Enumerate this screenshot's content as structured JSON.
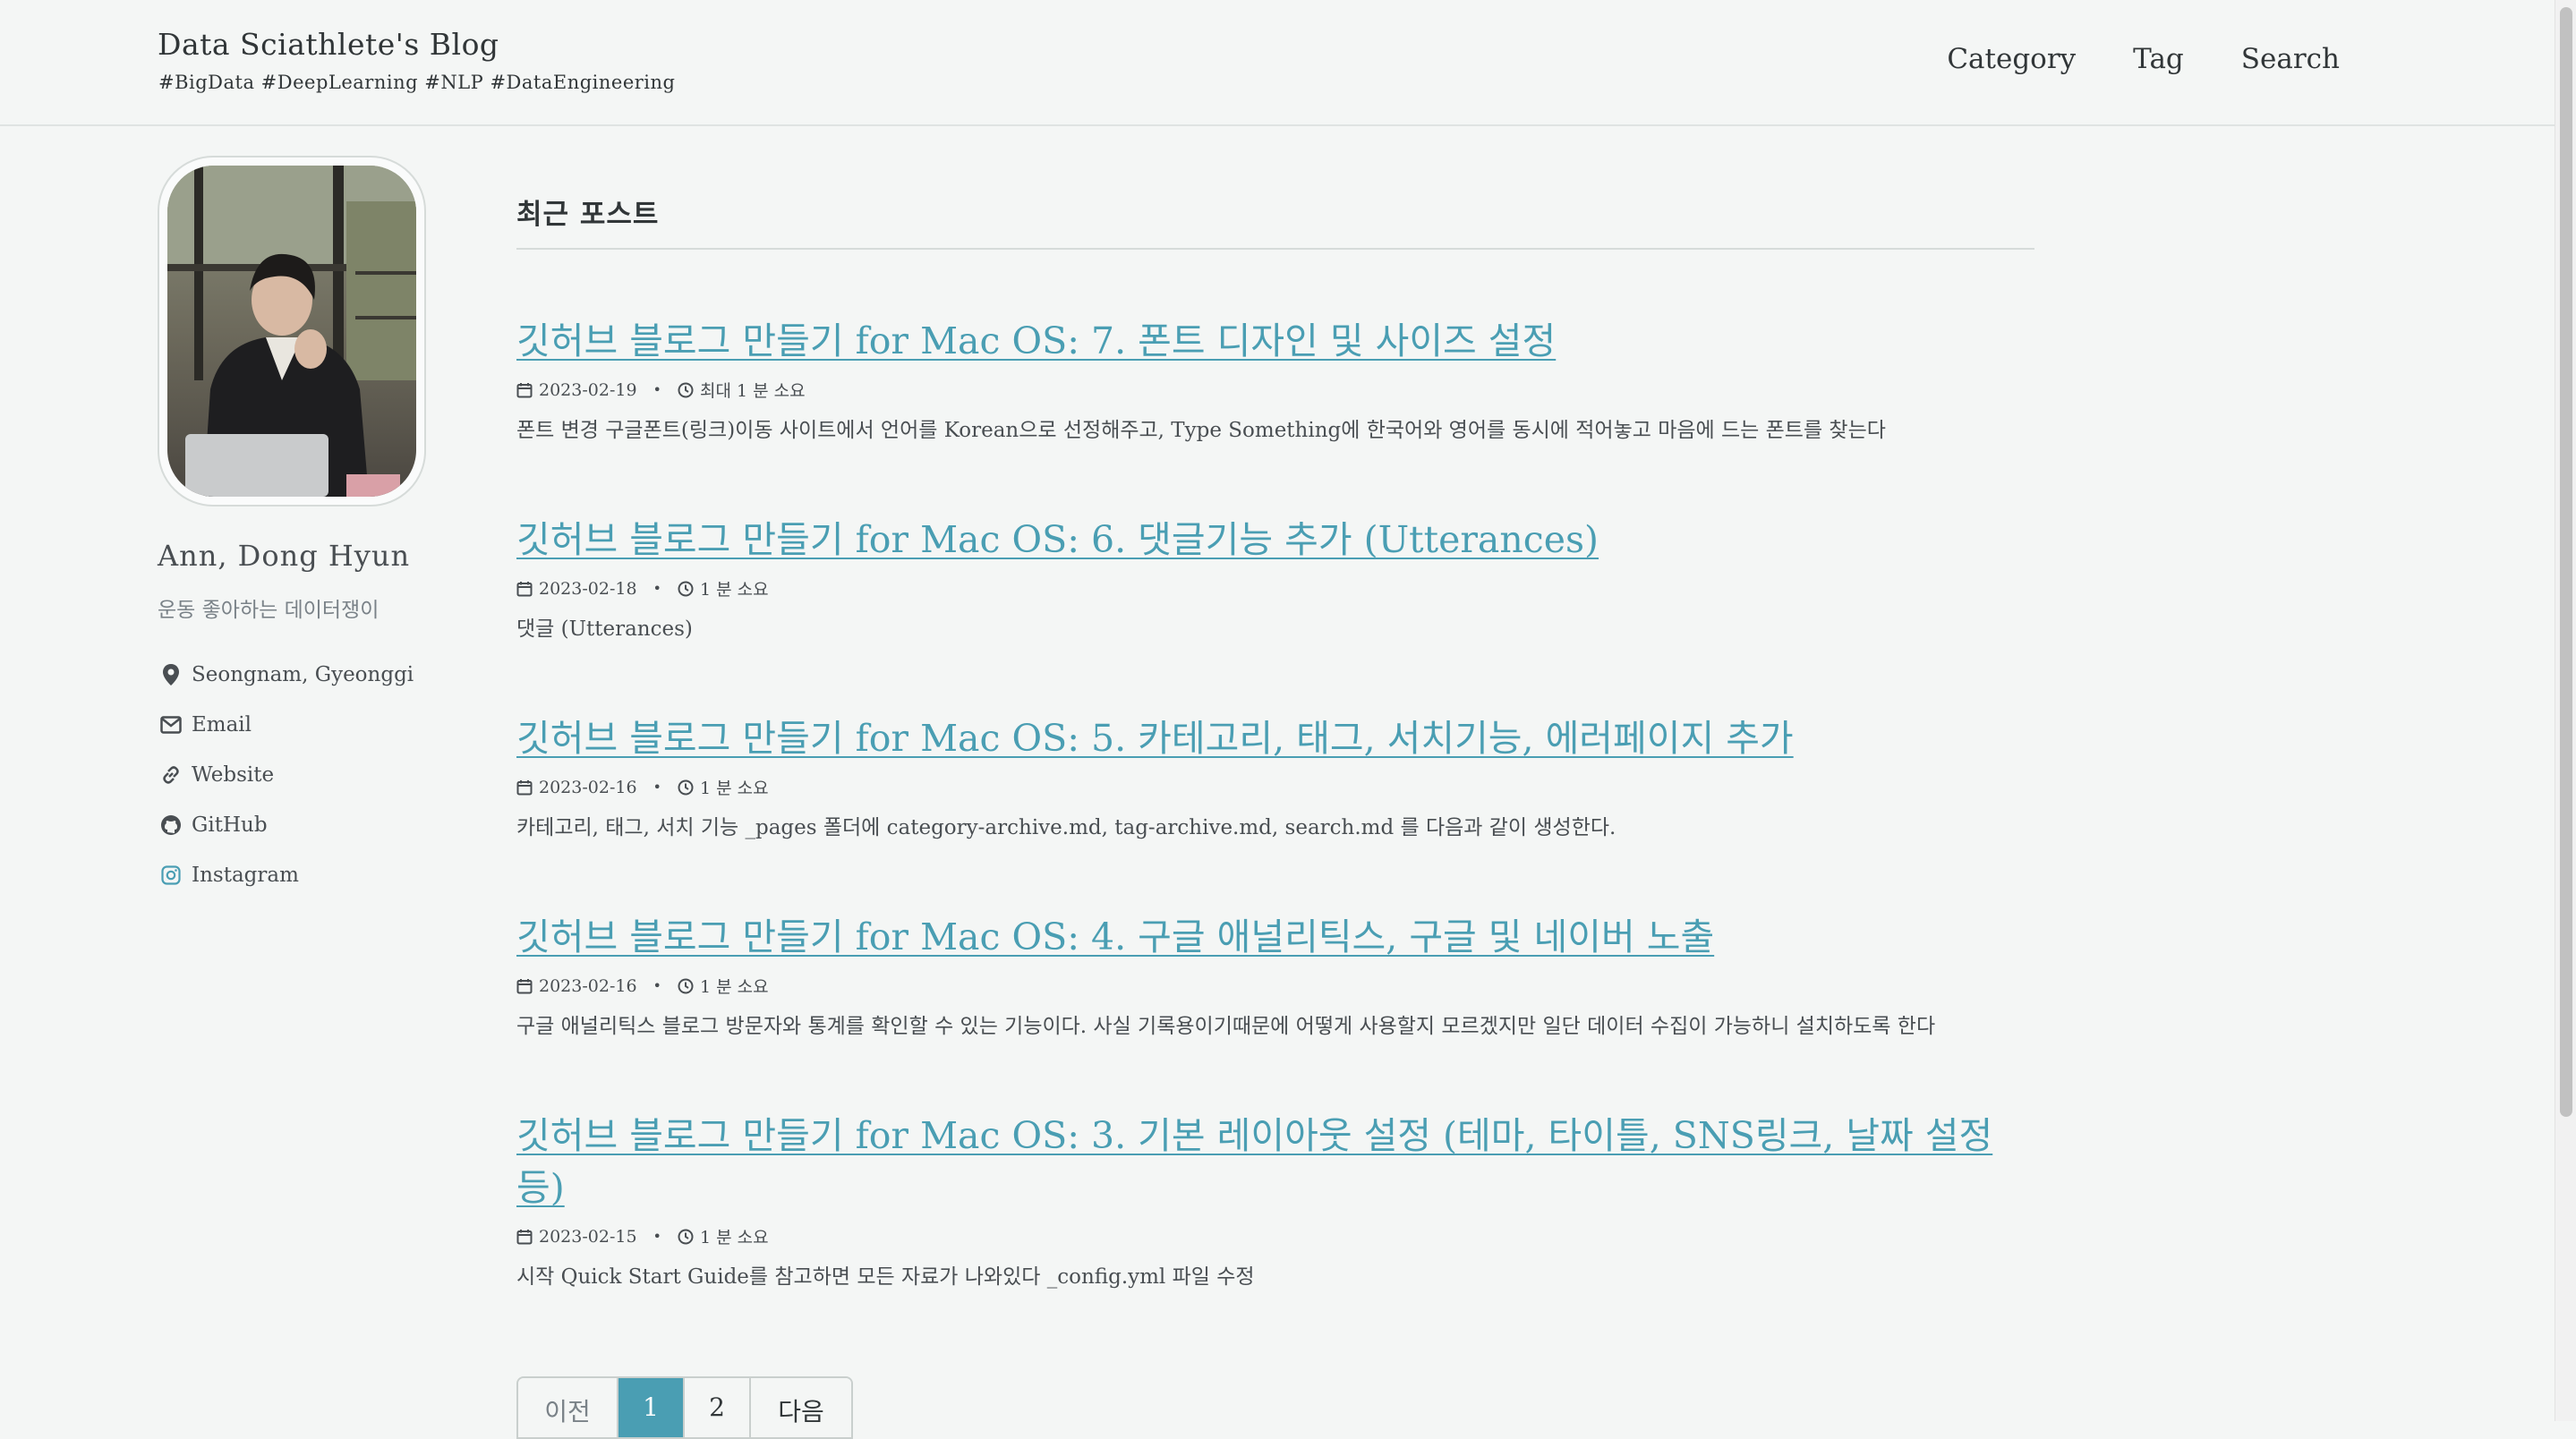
{
  "masthead": {
    "site_title": "Data Sciathlete's Blog",
    "site_subtitle": "#BigData #DeepLearning #NLP #DataEngineering",
    "nav": [
      "Category",
      "Tag",
      "Search"
    ]
  },
  "sidebar": {
    "author_name": "Ann, Dong Hyun",
    "author_bio": "운동 좋아하는 데이터쟁이",
    "links": [
      {
        "icon": "location-icon",
        "label": "Seongnam, Gyeonggi"
      },
      {
        "icon": "email-icon",
        "label": "Email"
      },
      {
        "icon": "link-icon",
        "label": "Website"
      },
      {
        "icon": "github-icon",
        "label": "GitHub"
      },
      {
        "icon": "instagram-icon",
        "label": "Instagram"
      }
    ]
  },
  "main": {
    "section_title": "최근 포스트",
    "posts": [
      {
        "title": "깃허브 블로그 만들기 for Mac OS: 7. 폰트 디자인 및 사이즈 설정",
        "date": "2023-02-19",
        "read_time": "최대 1 분 소요",
        "excerpt": "폰트 변경 구글폰트(링크)이동 사이트에서 언어를 Korean으로 선정해주고, Type Something에 한국어와 영어를 동시에 적어놓고 마음에 드는 폰트를 찾는다"
      },
      {
        "title": "깃허브 블로그 만들기 for Mac OS: 6. 댓글기능 추가 (Utterances)",
        "date": "2023-02-18",
        "read_time": "1 분 소요",
        "excerpt": "댓글 (Utterances)"
      },
      {
        "title": "깃허브 블로그 만들기 for Mac OS: 5. 카테고리, 태그, 서치기능, 에러페이지 추가",
        "date": "2023-02-16",
        "read_time": "1 분 소요",
        "excerpt": "카테고리, 태그, 서치 기능 _pages 폴더에 category-archive.md, tag-archive.md, search.md 를 다음과 같이 생성한다."
      },
      {
        "title": "깃허브 블로그 만들기 for Mac OS: 4. 구글 애널리틱스, 구글 및 네이버 노출",
        "date": "2023-02-16",
        "read_time": "1 분 소요",
        "excerpt": "구글 애널리틱스 블로그 방문자와 통계를 확인할 수 있는 기능이다. 사실 기록용이기때문에 어떻게 사용할지 모르겠지만 일단 데이터 수집이 가능하니 설치하도록 한다"
      },
      {
        "title": "깃허브 블로그 만들기 for Mac OS: 3. 기본 레이아웃 설정 (테마, 타이틀, SNS링크, 날짜 설정 등)",
        "date": "2023-02-15",
        "read_time": "1 분 소요",
        "excerpt": "시작 Quick Start Guide를 참고하면 모든 자료가 나와있다 _config.yml 파일 수정"
      }
    ]
  },
  "pagination": {
    "prev": "이전",
    "pages": [
      "1",
      "2"
    ],
    "current": "1",
    "next": "다음"
  },
  "colors": {
    "link": "#4a9eb3",
    "background": "#f4f6f5",
    "text": "#494e52"
  }
}
